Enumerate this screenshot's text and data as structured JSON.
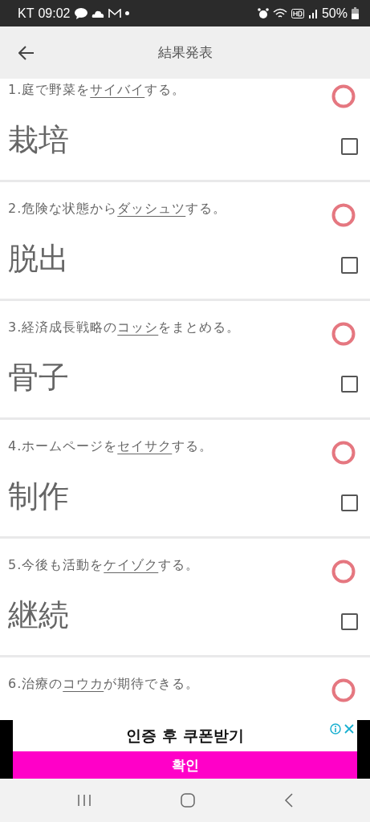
{
  "status_bar": {
    "carrier": "KT",
    "time": "09:02",
    "battery": "50%"
  },
  "header": {
    "title": "結果発表"
  },
  "items": [
    {
      "number": "1.",
      "before": "庭で野菜を",
      "target": "サイバイ",
      "after": "する。",
      "answer": "栽培",
      "correct": true,
      "checked": false
    },
    {
      "number": "2.",
      "before": "危険な状態から",
      "target": "ダッシュツ",
      "after": "する。",
      "answer": "脱出",
      "correct": true,
      "checked": false
    },
    {
      "number": "3.",
      "before": "経済成長戦略の",
      "target": "コッシ",
      "after": "をまとめる。",
      "answer": "骨子",
      "correct": true,
      "checked": false
    },
    {
      "number": "4.",
      "before": "ホームページを",
      "target": "セイサク",
      "after": "する。",
      "answer": "制作",
      "correct": true,
      "checked": false
    },
    {
      "number": "5.",
      "before": "今後も活動を",
      "target": "ケイゾク",
      "after": "する。",
      "answer": "継続",
      "correct": true,
      "checked": false
    },
    {
      "number": "6.",
      "before": "治療の",
      "target": "コウカ",
      "after": "が期待できる。",
      "correct": true
    }
  ],
  "ad": {
    "headline": "인증 후 쿠폰받기",
    "button": "확인"
  }
}
